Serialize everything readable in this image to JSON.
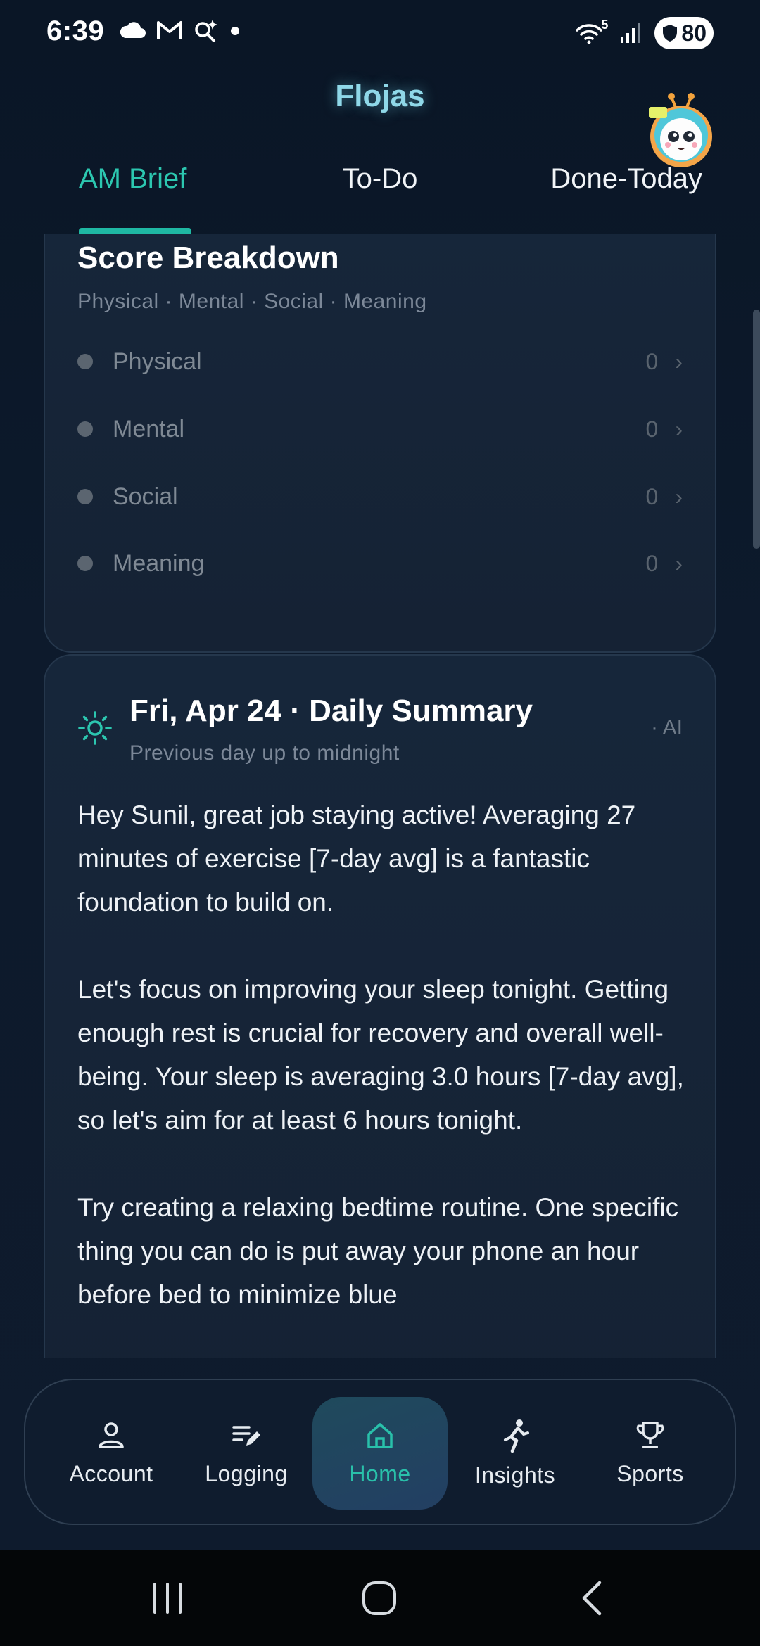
{
  "status_bar": {
    "time": "6:39",
    "left_icons": [
      "cloud-icon",
      "gmail-icon",
      "assistant-icon",
      "notification-dot-icon"
    ],
    "right_icons": [
      "wifi-icon",
      "signal-icon",
      "battery-icon"
    ],
    "wifi_label": "5",
    "battery_level": "80"
  },
  "header": {
    "app_title": "Flojas",
    "tabs": [
      {
        "label": "AM Brief",
        "active": true
      },
      {
        "label": "To-Do",
        "active": false
      },
      {
        "label": "Done-Today",
        "active": false
      }
    ]
  },
  "score_breakdown": {
    "title": "Score Breakdown",
    "subtitle": "Physical · Mental · Social · Meaning",
    "rows": [
      {
        "label": "Physical",
        "value": "0"
      },
      {
        "label": "Mental",
        "value": "0"
      },
      {
        "label": "Social",
        "value": "0"
      },
      {
        "label": "Meaning",
        "value": "0"
      }
    ]
  },
  "daily_summary": {
    "title": "Fri, Apr 24 · Daily Summary",
    "subtitle": "Previous day up to midnight",
    "tag": "· AI",
    "paragraphs": [
      "Hey Sunil, great job staying active! Averaging 27 minutes of exercise [7-day avg] is a fantastic foundation to build on.",
      "Let's focus on improving your sleep tonight. Getting enough rest is crucial for recovery and overall well-being. Your sleep is averaging 3.0 hours [7-day avg], so let's aim for at least 6 hours tonight.",
      "Try creating a relaxing bedtime routine. One specific thing you can do is put away your phone an hour before bed to minimize blue"
    ]
  },
  "bottom_nav": {
    "items": [
      {
        "label": "Account",
        "icon": "person-icon"
      },
      {
        "label": "Logging",
        "icon": "edit-list-icon"
      },
      {
        "label": "Home",
        "icon": "home-icon",
        "active": true
      },
      {
        "label": "Insights",
        "icon": "runner-icon"
      },
      {
        "label": "Sports",
        "icon": "trophy-icon"
      }
    ]
  },
  "system_nav": {
    "items": [
      "recents-icon",
      "home-circle-icon",
      "back-icon"
    ]
  },
  "colors": {
    "accent": "#2cc7b0",
    "background": "#0c1726",
    "card": "#16263a",
    "title_glow": "#8fd8e8"
  }
}
